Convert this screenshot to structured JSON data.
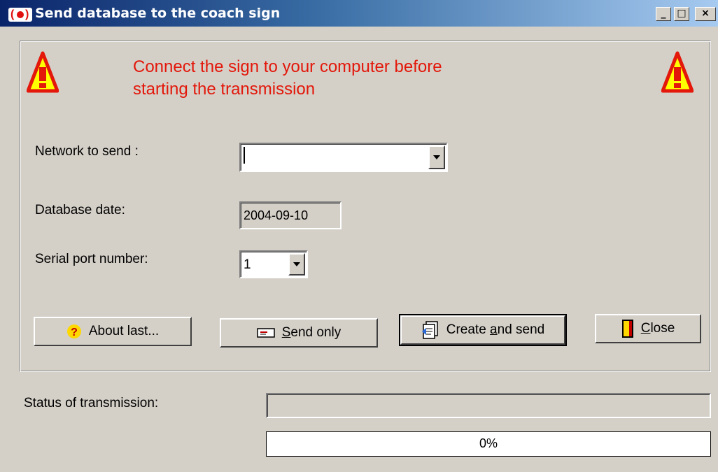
{
  "window": {
    "title": "Send database to the coach sign",
    "controls": {
      "minimize": "_",
      "maximize": "□",
      "close": "×"
    },
    "icon": "sign-app-icon"
  },
  "warning": {
    "message_line1": "Connect the sign to your computer before",
    "message_line2": "starting the transmission",
    "icon": "warning-triangle-icon",
    "color": "#e3170a"
  },
  "form": {
    "network_label": "Network to send :",
    "network_value": "",
    "date_label": "Database date:",
    "date_value": "2004-09-10",
    "port_label": "Serial port number:",
    "port_value": "1"
  },
  "buttons": {
    "about": {
      "label": "About last...",
      "icon": "help-question-icon"
    },
    "send_only": {
      "pre": "",
      "mnemonic": "S",
      "post": "end only",
      "icon": "envelope-icon"
    },
    "create_send": {
      "pre": "Create ",
      "mnemonic": "a",
      "post": "nd send",
      "icon": "document-send-icon"
    },
    "close": {
      "pre": "",
      "mnemonic": "C",
      "post": "lose",
      "icon": "door-exit-icon"
    }
  },
  "status": {
    "label": "Status of transmission:",
    "message": "",
    "progress_fraction": 0,
    "progress_text": "0%"
  }
}
